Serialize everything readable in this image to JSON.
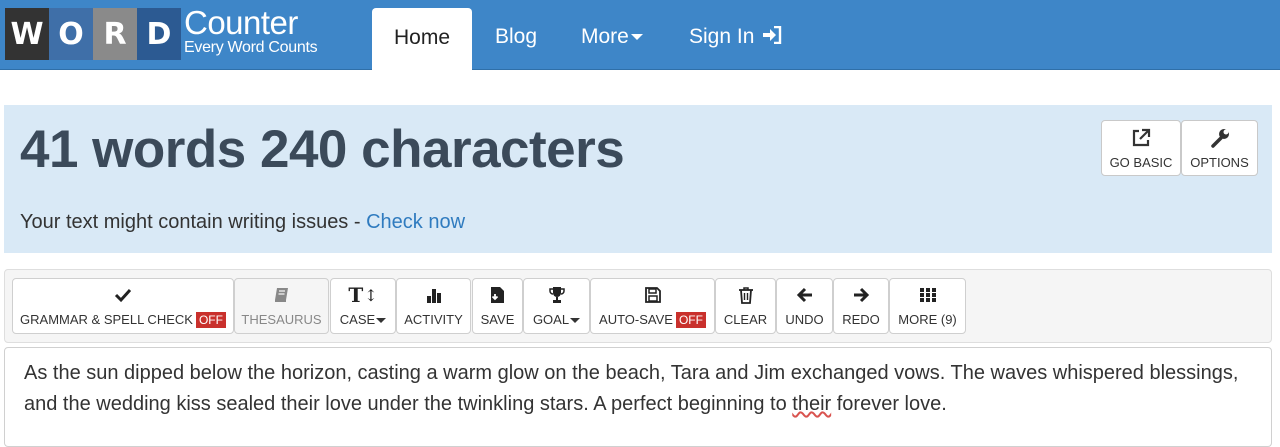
{
  "logo": {
    "letters": [
      "W",
      "O",
      "R",
      "D"
    ],
    "title": "Counter",
    "subtitle": "Every Word Counts"
  },
  "nav": {
    "home": "Home",
    "blog": "Blog",
    "more": "More",
    "signin": "Sign In"
  },
  "stats": {
    "heading": "41 words 240 characters",
    "notice_prefix": "Your text might contain writing issues - ",
    "notice_link": "Check now",
    "go_basic": "GO BASIC",
    "options": "OPTIONS"
  },
  "toolbar": {
    "grammar": "GRAMMAR & SPELL CHECK",
    "grammar_state": "OFF",
    "thesaurus": "THESAURUS",
    "case": "CASE",
    "activity": "ACTIVITY",
    "save": "SAVE",
    "goal": "GOAL",
    "autosave": "AUTO-SAVE",
    "autosave_state": "OFF",
    "clear": "CLEAR",
    "undo": "UNDO",
    "redo": "REDO",
    "more": "MORE (9)"
  },
  "editor": {
    "text_before": "As the sun dipped below the horizon, casting a warm glow on the beach, Tara and Jim exchanged vows. The waves whispered blessings, and the wedding kiss sealed their love under the twinkling stars. A perfect beginning to ",
    "misspelled": "their",
    "text_after": " forever love."
  },
  "colors": {
    "nav_bg": "#3e86c8",
    "stats_bg": "#d9e9f6",
    "off_badge": "#c9302c",
    "link": "#2f7bbf"
  }
}
